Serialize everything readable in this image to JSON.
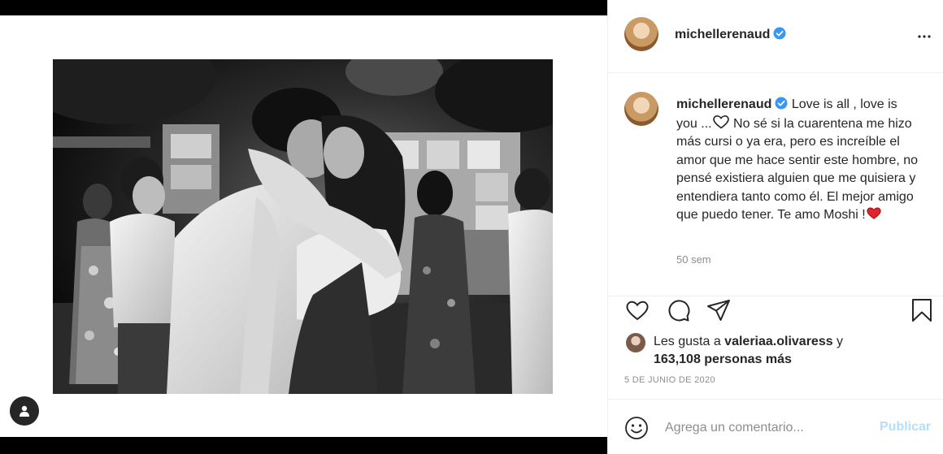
{
  "post": {
    "username": "michellerenaud",
    "caption_text_1": " Love is all , love is you ...",
    "caption_text_2": " No sé si la cuarentena me hizo más cursi o ya era, pero es increíble el amor que me hace sentir este hombre, no pensé existiera alguien que me quisiera y entendiera tanto como él. El mejor amigo que puedo tener. Te amo Moshi !",
    "time_ago": "50 sem",
    "likes_prefix": "Les gusta a ",
    "liked_by": "valeriaa.olivaress",
    "likes_connector": " y",
    "likes_others": "163,108 personas más",
    "date": "5 DE JUNIO DE 2020"
  },
  "comment": {
    "placeholder": "Agrega un comentario...",
    "publish_label": "Publicar"
  },
  "colors": {
    "verified": "#3897f0",
    "heart_red": "#ed4956",
    "publish_disabled": "#b2dffc"
  }
}
